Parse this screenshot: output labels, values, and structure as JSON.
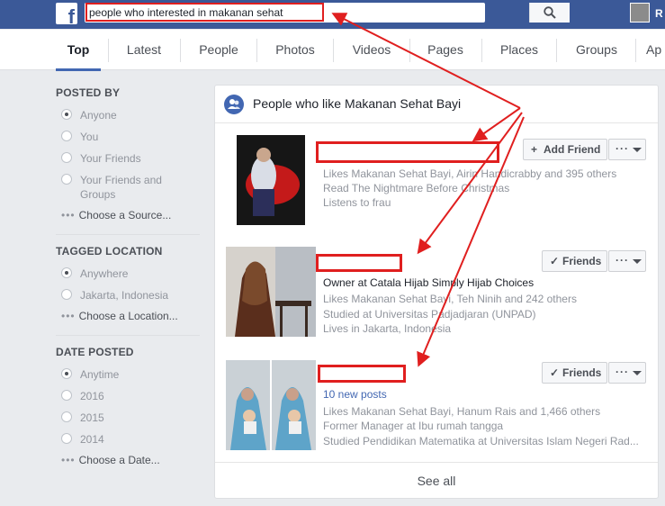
{
  "topbar": {
    "logo": "f",
    "search_value": "people who interested in makanan sehat",
    "search_icon": "search-icon",
    "user_initial": "R"
  },
  "tabs": [
    {
      "label": "Top",
      "active": true
    },
    {
      "label": "Latest"
    },
    {
      "label": "People"
    },
    {
      "label": "Photos"
    },
    {
      "label": "Videos"
    },
    {
      "label": "Pages"
    },
    {
      "label": "Places"
    },
    {
      "label": "Groups"
    },
    {
      "label": "Ap"
    }
  ],
  "sidebar": {
    "posted_by": {
      "heading": "POSTED BY",
      "options": [
        "Anyone",
        "You",
        "Your Friends",
        "Your Friends and",
        "Groups"
      ],
      "more": "Choose a Source..."
    },
    "tagged_location": {
      "heading": "TAGGED LOCATION",
      "options": [
        "Anywhere",
        "Jakarta, Indonesia"
      ],
      "more": "Choose a Location..."
    },
    "date_posted": {
      "heading": "DATE POSTED",
      "options": [
        "Anytime",
        "2016",
        "2015",
        "2014"
      ],
      "more": "Choose a Date..."
    }
  },
  "card": {
    "title": "People who like Makanan Sehat Bayi",
    "see_all": "See all",
    "results": [
      {
        "button": "Add Friend",
        "lines": [
          "Likes Makanan Sehat Bayi, Airin Handicrabby and 395 others",
          "Read The Nightmare Before Christmas",
          "Listens to frau"
        ]
      },
      {
        "button": "Friends",
        "primary": "Owner at Catala Hijab Simply Hijab Choices",
        "lines": [
          "Likes Makanan Sehat Bayi, Teh Ninih and 242 others",
          "Studied at Universitas Padjadjaran (UNPAD)",
          "Lives in Jakarta, Indonesia"
        ]
      },
      {
        "button": "Friends",
        "link": "10 new posts",
        "lines": [
          "Likes Makanan Sehat Bayi, Hanum Rais and 1,466 others",
          "Former Manager at Ibu rumah tangga",
          "Studied Pendidikan Matematika at Universitas Islam Negeri Rad..."
        ]
      }
    ]
  },
  "colors": {
    "brand": "#3b5998",
    "annotation": "#e01f1f",
    "link": "#4267b2"
  }
}
